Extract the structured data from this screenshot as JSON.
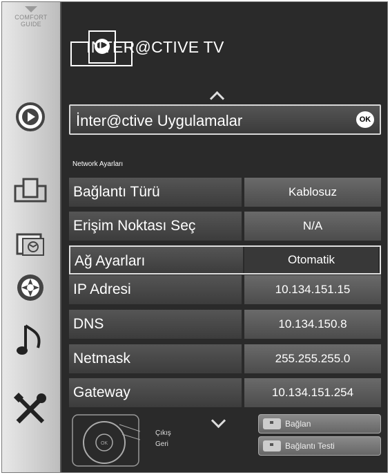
{
  "sidebar": {
    "comfort_guide": "COMFORT GUIDE",
    "items": [
      {
        "icon": "play-icon"
      },
      {
        "icon": "apps-icon"
      },
      {
        "icon": "gallery-icon"
      },
      {
        "icon": "media-icon"
      },
      {
        "icon": "music-icon"
      },
      {
        "icon": "tools-icon"
      }
    ]
  },
  "header": {
    "title": "INTER@CTIVE TV",
    "icon": "interactive-tv-icon"
  },
  "apps_row": {
    "label": "İnter@ctive Uygulamalar",
    "ok": "OK"
  },
  "section_title": "Network Ayarları",
  "settings": [
    {
      "label": "Bağlantı Türü",
      "value": "Kablosuz"
    },
    {
      "label": "Erişim Noktası Seç",
      "value": "N/A"
    },
    {
      "label": "Ağ Ayarları",
      "value": "Otomatik"
    },
    {
      "label": "IP Adresi",
      "value": "10.134.151.15"
    },
    {
      "label": "DNS",
      "value": "10.134.150.8"
    },
    {
      "label": "Netmask",
      "value": "255.255.255.0"
    },
    {
      "label": "Gateway",
      "value": "10.134.151.254"
    }
  ],
  "footer": {
    "legend_exit": "Çıkış",
    "legend_back": "Geri",
    "remote_ok": "OK",
    "connect_button": "Bağlan",
    "connection_test_button": "Bağlantı Testi"
  },
  "colors": {
    "background": "#2a2a2a",
    "sidebar": "#d6d6d6",
    "text": "#ffffff"
  }
}
